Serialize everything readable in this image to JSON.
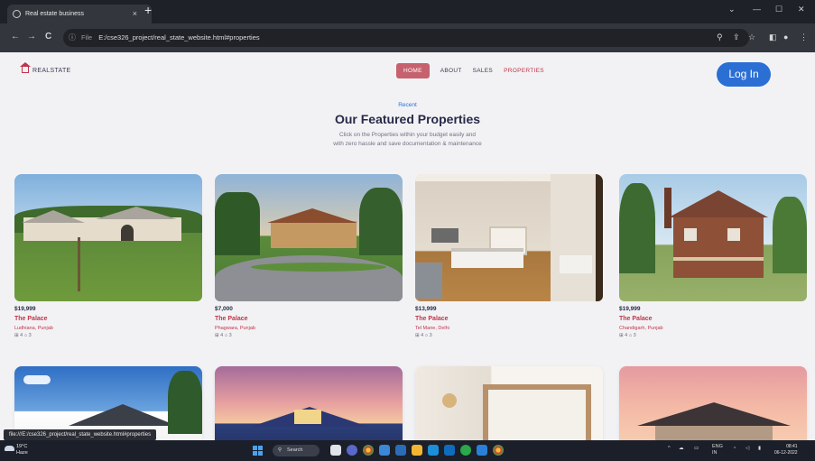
{
  "browser": {
    "tab_title": "Real estate business",
    "tab_close": "×",
    "new_tab": "+",
    "url_prefix": "File",
    "url": "E:/cse326_project/real_state_website.html#properties",
    "back": "←",
    "forward": "→",
    "reload": "C",
    "win_minimize": "—",
    "win_maximize": "☐",
    "win_close": "✕",
    "win_dropdown": "⌄"
  },
  "site": {
    "logo_text": "REALSTATE",
    "nav": [
      "HOME",
      "ABOUT",
      "SALES",
      "PROPERTIES"
    ],
    "login_label": "Log In"
  },
  "hero": {
    "kicker": "Recent",
    "title": "Our Featured Properties",
    "subtitle_line1": "Click on the Properties within your budget easily and",
    "subtitle_line2": "with zero hassle and save documentation & maintenance"
  },
  "properties": [
    {
      "price": "$19,999",
      "name": "The Palace",
      "location": "Ludhiana, Punjab",
      "specs": "⊞ 4   ⌂ 3",
      "scene": "ranch"
    },
    {
      "price": "$7,000",
      "name": "The Palace",
      "location": "Phagwara, Punjab",
      "specs": "⊞ 4   ⌂ 3",
      "scene": "villa"
    },
    {
      "price": "$13,999",
      "name": "The Palace",
      "location": "Tel Mane, Delhi",
      "specs": "⊞ 4   ⌂ 3",
      "scene": "interior"
    },
    {
      "price": "$19,999",
      "name": "The Palace",
      "location": "Chandigarh, Punjab",
      "specs": "⊞ 4   ⌂ 3",
      "scene": "brick"
    }
  ],
  "status_link": "file:///E:/cse326_project/real_state_website.html#properties",
  "taskbar": {
    "weather_temp": "19°C",
    "weather_desc": "Haze",
    "search_label": "Search",
    "tray_lang": "ENG",
    "tray_region": "IN",
    "time": "08:41",
    "date": "06-12-2022"
  },
  "colors": {
    "accent": "#c0344a",
    "brand_blue": "#2b6fd4",
    "nav_active": "#c6626e",
    "title": "#262a48"
  }
}
